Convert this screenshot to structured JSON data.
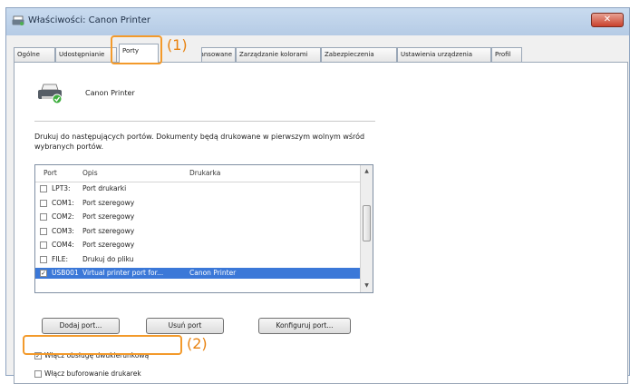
{
  "window": {
    "title": "Właściwości: Canon Printer",
    "close_glyph": "✕"
  },
  "tabs": [
    {
      "label": "Ogólne"
    },
    {
      "label": "Udostępnianie"
    },
    {
      "label": "Porty",
      "active": true
    },
    {
      "label": "Zaawansowane"
    },
    {
      "label": "Zarządzanie kolorami"
    },
    {
      "label": "Zabezpieczenia"
    },
    {
      "label": "Ustawienia urządzenia"
    },
    {
      "label": "Profil"
    }
  ],
  "printer": {
    "name": "Canon Printer",
    "icon": "printer-icon"
  },
  "description": "Drukuj do następujących portów. Dokumenty będą drukowane w pierwszym wolnym wśród wybranych portów.",
  "ports": {
    "columns": [
      "Port",
      "Opis",
      "Drukarka"
    ],
    "rows": [
      {
        "port": "LPT3:",
        "desc": "Port drukarki",
        "printer": "",
        "checked": false,
        "selected": false
      },
      {
        "port": "COM1:",
        "desc": "Port szeregowy",
        "printer": "",
        "checked": false,
        "selected": false
      },
      {
        "port": "COM2:",
        "desc": "Port szeregowy",
        "printer": "",
        "checked": false,
        "selected": false
      },
      {
        "port": "COM3:",
        "desc": "Port szeregowy",
        "printer": "",
        "checked": false,
        "selected": false
      },
      {
        "port": "COM4:",
        "desc": "Port szeregowy",
        "printer": "",
        "checked": false,
        "selected": false
      },
      {
        "port": "FILE:",
        "desc": "Drukuj do pliku",
        "printer": "",
        "checked": false,
        "selected": false
      },
      {
        "port": "USB001",
        "desc": "Virtual printer port for...",
        "printer": "Canon Printer",
        "checked": true,
        "selected": true
      }
    ]
  },
  "buttons": {
    "add_port": "Dodaj port...",
    "delete_port": "Usuń port",
    "configure_port": "Konfiguruj port..."
  },
  "options": {
    "bidirectional": {
      "label": "Włącz obsługę dwukierunkową",
      "checked": true
    },
    "pooling": {
      "label": "Włącz buforowanie drukarek",
      "checked": false
    }
  },
  "callouts": {
    "one": "(1)",
    "two": "(2)"
  },
  "colors": {
    "highlight": "#f39a2b",
    "selection": "#3b78d8"
  }
}
